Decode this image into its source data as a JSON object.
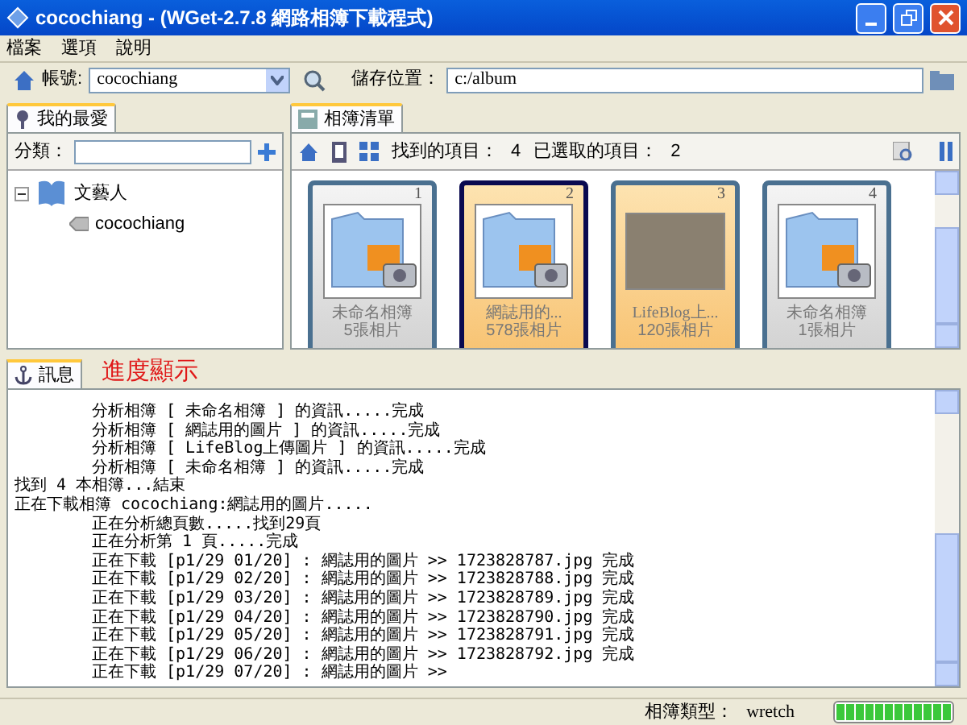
{
  "window": {
    "title": "cocochiang - (WGet-2.7.8 網路相簿下載程式)"
  },
  "menu": [
    "檔案",
    "選項",
    "說明"
  ],
  "toolbar": {
    "account_label": "帳號:",
    "account": "cocochiang",
    "save_label": "儲存位置：",
    "save_path": "c:/album"
  },
  "favorites": {
    "tab": "我的最愛",
    "category_label": "分類：",
    "tree": [
      {
        "label": "文藝人",
        "expanded": true,
        "children": [
          {
            "label": "cocochiang"
          }
        ]
      }
    ]
  },
  "albums": {
    "tab": "相簿清單",
    "found_label": "找到的項目：",
    "found": "4",
    "selected_label": "已選取的項目：",
    "selected_count": "2",
    "items": [
      {
        "number": "1",
        "name": "未命名相簿",
        "count": "5張相片",
        "kind": "folder",
        "selected": false,
        "focused": false
      },
      {
        "number": "2",
        "name": "網誌用的...",
        "count": "578張相片",
        "kind": "folder",
        "selected": true,
        "focused": true
      },
      {
        "number": "3",
        "name": "LifeBlog上...",
        "count": "120張相片",
        "kind": "photo",
        "selected": true,
        "focused": false
      },
      {
        "number": "4",
        "name": "未命名相簿",
        "count": "1張相片",
        "kind": "folder",
        "selected": false,
        "focused": false
      }
    ]
  },
  "log": {
    "tab": "訊息",
    "annotation": "進度顯示",
    "lines": [
      {
        "text": "分析相簿 [ 未命名相簿 ] 的資訊.....完成",
        "indented": true
      },
      {
        "text": "分析相簿 [ 網誌用的圖片 ] 的資訊.....完成",
        "indented": true
      },
      {
        "text": "分析相簿 [ LifeBlog上傳圖片 ] 的資訊.....完成",
        "indented": true
      },
      {
        "text": "分析相簿 [ 未命名相簿 ] 的資訊.....完成",
        "indented": true
      },
      {
        "text": "找到 4 本相簿...結束",
        "indented": false
      },
      {
        "text": "正在下載相簿 cocochiang:網誌用的圖片.....",
        "indented": false
      },
      {
        "text": "正在分析總頁數.....找到29頁",
        "indented": true
      },
      {
        "text": "正在分析第 1 頁.....完成",
        "indented": true
      },
      {
        "text": "正在下載 [p1/29 01/20] : 網誌用的圖片 >> 1723828787.jpg 完成",
        "indented": true
      },
      {
        "text": "正在下載 [p1/29 02/20] : 網誌用的圖片 >> 1723828788.jpg 完成",
        "indented": true
      },
      {
        "text": "正在下載 [p1/29 03/20] : 網誌用的圖片 >> 1723828789.jpg 完成",
        "indented": true
      },
      {
        "text": "正在下載 [p1/29 04/20] : 網誌用的圖片 >> 1723828790.jpg 完成",
        "indented": true
      },
      {
        "text": "正在下載 [p1/29 05/20] : 網誌用的圖片 >> 1723828791.jpg 完成",
        "indented": true
      },
      {
        "text": "正在下載 [p1/29 06/20] : 網誌用的圖片 >> 1723828792.jpg 完成",
        "indented": true
      },
      {
        "text": "正在下載 [p1/29 07/20] : 網誌用的圖片 >>",
        "indented": true
      }
    ]
  },
  "status_bar": {
    "type_label": "相簿類型：",
    "type": "wretch",
    "level": 1
  }
}
